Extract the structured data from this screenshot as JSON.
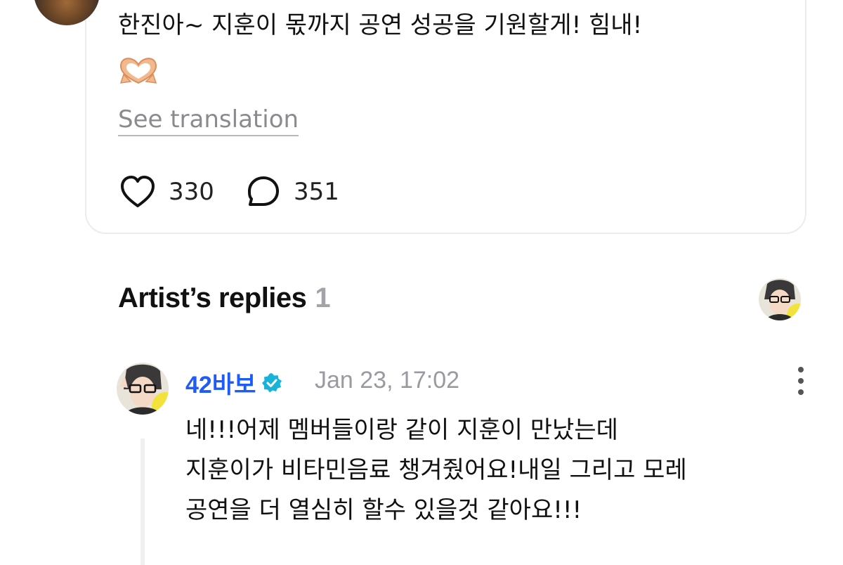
{
  "post": {
    "text": "한진아~ 지훈이 몫까지 공연 성공을 기원할게! 힘내!",
    "translate_label": "See translation",
    "likes": "330",
    "comments": "351"
  },
  "replies_section": {
    "title": "Artist’s replies",
    "count": "1"
  },
  "reply": {
    "author": "42바보",
    "time": "Jan 23, 17:02",
    "lines": [
      "네!!!어제 멤버들이랑 같이 지훈이 만났는데",
      "지훈이가 비타민음료 챙겨줬어요!내일 그리고 모레",
      "공연을 더 열심히 할수 있을것 같아요!!!"
    ]
  },
  "colors": {
    "accent_name": "#1f5bf5",
    "verified": "#17b3d9",
    "muted": "#9a9aa0"
  },
  "icons": {
    "post_emoji": "heart-hands-icon",
    "like": "heart-outline-icon",
    "comment": "speech-bubble-icon",
    "verified": "verified-badge-icon",
    "menu": "more-vertical-icon"
  }
}
